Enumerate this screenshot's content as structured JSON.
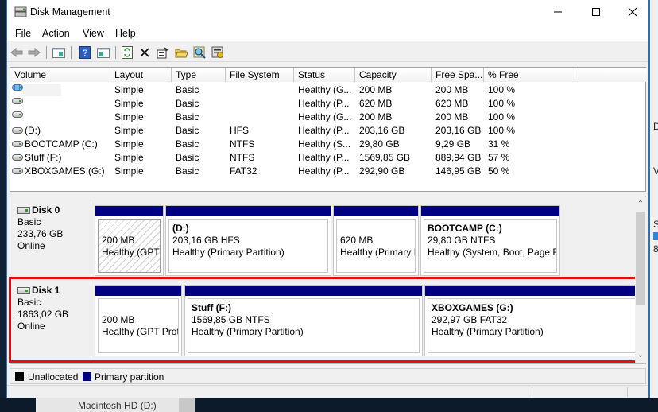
{
  "window": {
    "title": "Disk Management",
    "controls": {
      "minimize": "minimize",
      "maximize": "maximize",
      "close": "close"
    }
  },
  "menu": [
    "File",
    "Action",
    "View",
    "Help"
  ],
  "toolbar": {
    "icons": [
      "back-arrow-icon",
      "forward-arrow-icon",
      "show-hide-console-tree-icon",
      "help-icon",
      "show-hide-action-pane-icon",
      "refresh-icon",
      "delete-icon",
      "properties-icon",
      "open-folder-icon",
      "explore-icon",
      "settings-icon"
    ]
  },
  "volume_table": {
    "columns": [
      "Volume",
      "Layout",
      "Type",
      "File System",
      "Status",
      "Capacity",
      "Free Spa...",
      "% Free"
    ],
    "rows": [
      {
        "volume": "",
        "icon": "blue",
        "layout": "Simple",
        "type": "Basic",
        "fs": "",
        "status": "Healthy (G...",
        "capacity": "200 MB",
        "free": "200 MB",
        "pct": "100 %"
      },
      {
        "volume": "",
        "icon": "gray",
        "layout": "Simple",
        "type": "Basic",
        "fs": "",
        "status": "Healthy (P...",
        "capacity": "620 MB",
        "free": "620 MB",
        "pct": "100 %"
      },
      {
        "volume": "",
        "icon": "gray",
        "layout": "Simple",
        "type": "Basic",
        "fs": "",
        "status": "Healthy (G...",
        "capacity": "200 MB",
        "free": "200 MB",
        "pct": "100 %"
      },
      {
        "volume": " (D:)",
        "icon": "gray",
        "layout": "Simple",
        "type": "Basic",
        "fs": "HFS",
        "status": "Healthy (P...",
        "capacity": "203,16 GB",
        "free": "203,16 GB",
        "pct": "100 %"
      },
      {
        "volume": "BOOTCAMP (C:)",
        "icon": "gray",
        "layout": "Simple",
        "type": "Basic",
        "fs": "NTFS",
        "status": "Healthy (S...",
        "capacity": "29,80 GB",
        "free": "9,29 GB",
        "pct": "31 %"
      },
      {
        "volume": "Stuff (F:)",
        "icon": "gray",
        "layout": "Simple",
        "type": "Basic",
        "fs": "NTFS",
        "status": "Healthy (P...",
        "capacity": "1569,85 GB",
        "free": "889,94 GB",
        "pct": "57 %"
      },
      {
        "volume": "XBOXGAMES (G:)",
        "icon": "gray",
        "layout": "Simple",
        "type": "Basic",
        "fs": "FAT32",
        "status": "Healthy (P...",
        "capacity": "292,90 GB",
        "free": "146,95 GB",
        "pct": "50 %"
      }
    ]
  },
  "disks": [
    {
      "name": "Disk 0",
      "kind": "Basic",
      "size": "233,76 GB",
      "state": "Online",
      "partitions": [
        {
          "title": "",
          "line1": "200 MB",
          "line2": "Healthy (GPT",
          "hatched": true
        },
        {
          "title": "(D:)",
          "line1": "203,16 GB HFS",
          "line2": "Healthy (Primary Partition)",
          "hatched": false
        },
        {
          "title": "",
          "line1": "620 MB",
          "line2": "Healthy (Primary I",
          "hatched": false
        },
        {
          "title": "BOOTCAMP  (C:)",
          "line1": "29,80 GB NTFS",
          "line2": "Healthy (System, Boot, Page Fi",
          "hatched": false
        }
      ]
    },
    {
      "name": "Disk 1",
      "kind": "Basic",
      "size": "1863,02 GB",
      "state": "Online",
      "partitions": [
        {
          "title": "",
          "line1": "200 MB",
          "line2": "Healthy (GPT Prot",
          "hatched": false
        },
        {
          "title": "Stuff  (F:)",
          "line1": "1569,85 GB NTFS",
          "line2": "Healthy (Primary Partition)",
          "hatched": false
        },
        {
          "title": "XBOXGAMES  (G:)",
          "line1": "292,97 GB FAT32",
          "line2": "Healthy (Primary Partition)",
          "hatched": false
        }
      ]
    }
  ],
  "legend": [
    {
      "label": "Unallocated",
      "color": "#000000"
    },
    {
      "label": "Primary partition",
      "color": "#000080"
    }
  ],
  "colors": {
    "partition_bar": "#000080",
    "highlight": "#ea0d0d",
    "window_border": "#2b6fb6"
  },
  "background": {
    "taskbar_text": "Macintosh HD (D:)",
    "right_fragments": [
      "D",
      "V",
      "S",
      "8"
    ]
  }
}
